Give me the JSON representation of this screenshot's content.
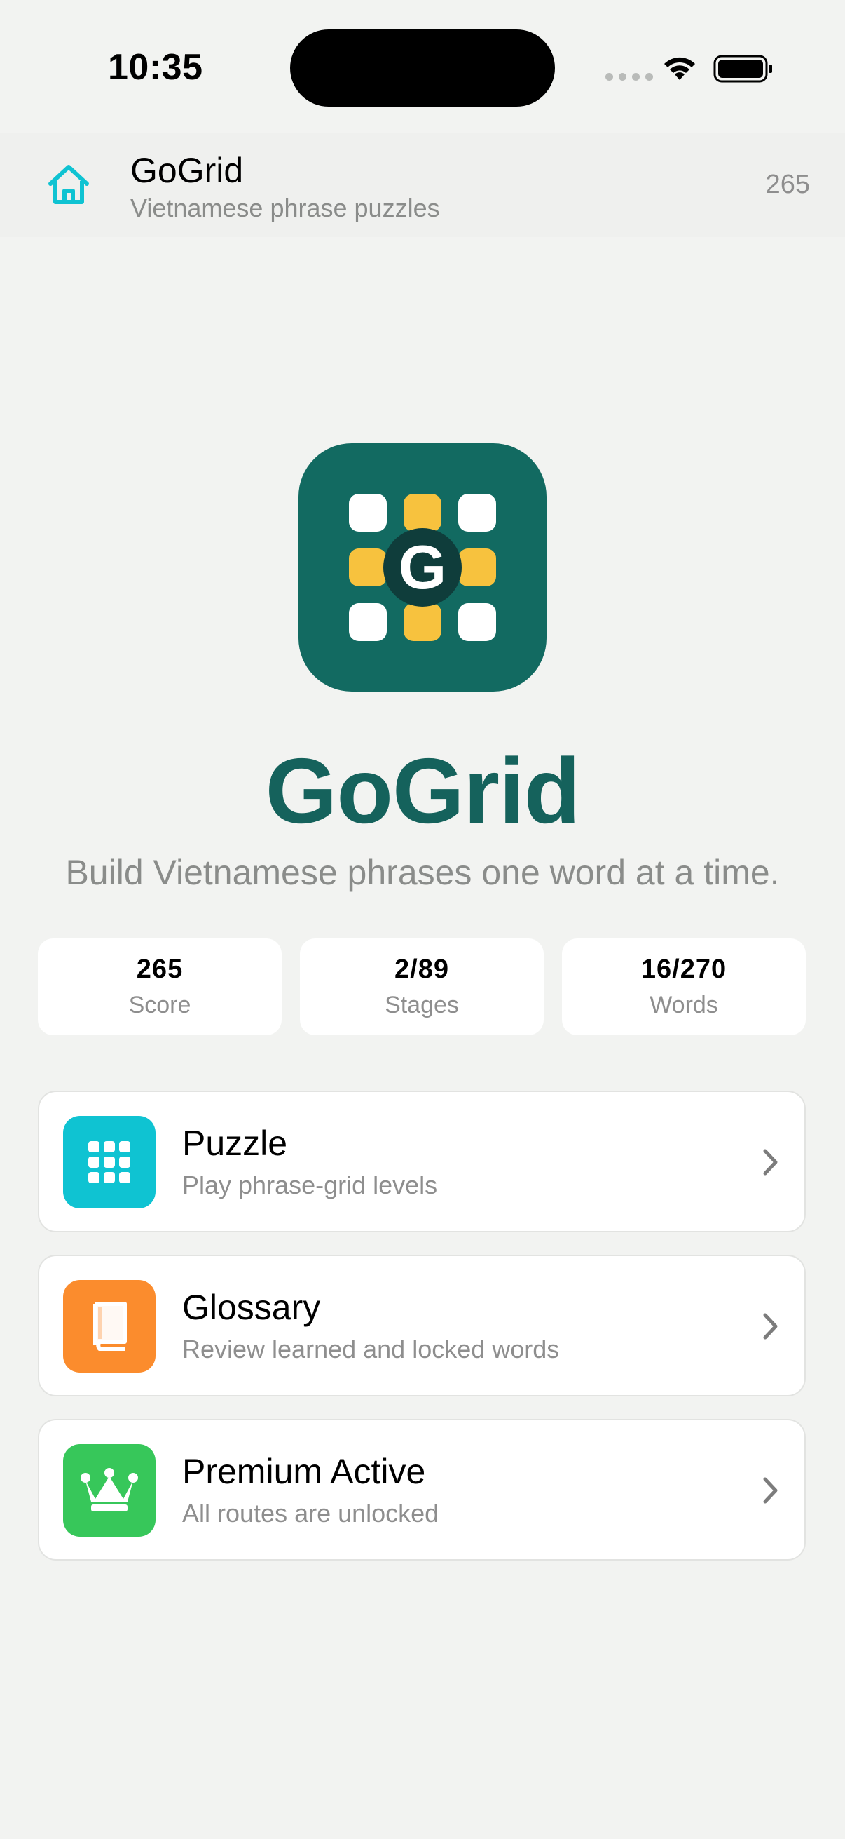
{
  "status_bar": {
    "time": "10:35"
  },
  "header": {
    "title": "GoGrid",
    "subtitle": "Vietnamese phrase puzzles",
    "score": "265"
  },
  "logo": {
    "letter": "G"
  },
  "brand": {
    "title": "GoGrid",
    "tagline": "Build Vietnamese phrases one word at a time."
  },
  "stats": [
    {
      "value": "265",
      "label": "Score"
    },
    {
      "value": "2/89",
      "label": "Stages"
    },
    {
      "value": "16/270",
      "label": "Words"
    }
  ],
  "menu": [
    {
      "title": "Puzzle",
      "subtitle": "Play phrase-grid levels",
      "icon": "grid-icon",
      "color": "#0fc3d2"
    },
    {
      "title": "Glossary",
      "subtitle": "Review learned and locked words",
      "icon": "book-icon",
      "color": "#fb8c2d"
    },
    {
      "title": "Premium Active",
      "subtitle": "All routes are unlocked",
      "icon": "crown-icon",
      "color": "#37c75a"
    }
  ],
  "colors": {
    "accent": "#0fc3d2",
    "brand": "#15625c",
    "logo_bg": "#126a61",
    "logo_tile_yellow": "#f7c23e"
  }
}
